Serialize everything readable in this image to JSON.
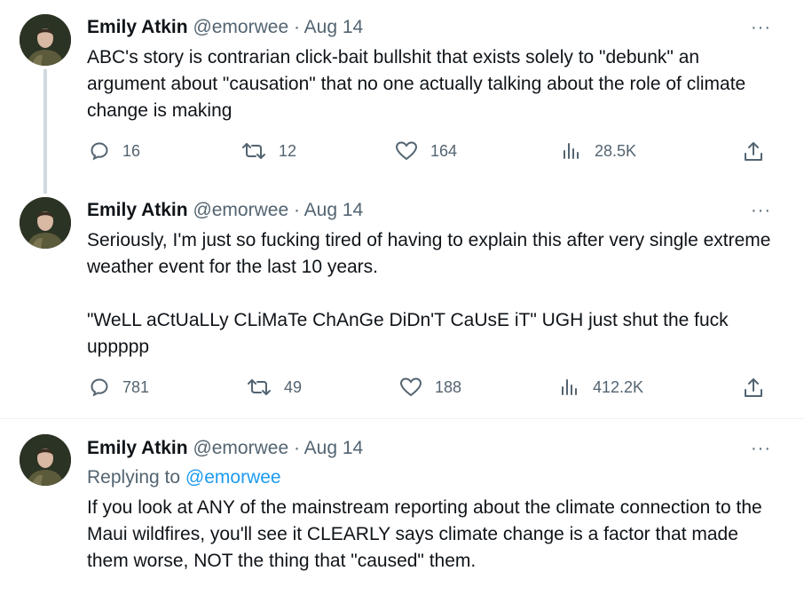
{
  "tweets": [
    {
      "name": "Emily Atkin",
      "handle": "@emorwee",
      "dot": "·",
      "date": "Aug 14",
      "more": "···",
      "text": "ABC's story is contrarian click-bait bullshit that exists solely to \"debunk\" an argument about \"causation\" that no one actually talking about the role of climate change is making",
      "replies": "16",
      "retweets": "12",
      "likes": "164",
      "views": "28.5K"
    },
    {
      "name": "Emily Atkin",
      "handle": "@emorwee",
      "dot": "·",
      "date": "Aug 14",
      "more": "···",
      "text": "Seriously, I'm just so fucking tired of having to explain this after very single extreme weather event for the last 10 years.\n\n\"WeLL aCtUaLLy CLiMaTe ChAnGe DiDn'T CaUsE iT\" UGH just shut the fuck uppppp",
      "replies": "781",
      "retweets": "49",
      "likes": "188",
      "views": "412.2K"
    },
    {
      "name": "Emily Atkin",
      "handle": "@emorwee",
      "dot": "·",
      "date": "Aug 14",
      "more": "···",
      "replying_label": "Replying to",
      "replying_handle": "@emorwee",
      "text": "If you look at ANY of the mainstream reporting about the climate connection to the Maui wildfires, you'll see it CLEARLY says climate change is a factor that made them worse, NOT the thing that \"caused\" them."
    }
  ],
  "icons": {
    "reply": "reply-icon",
    "retweet": "retweet-icon",
    "like": "heart-icon",
    "views": "views-chart-icon",
    "share": "share-icon"
  },
  "colors": {
    "text": "#0f1419",
    "secondary": "#536471",
    "link": "#1d9bf0",
    "thread_line": "#cfd9de"
  }
}
